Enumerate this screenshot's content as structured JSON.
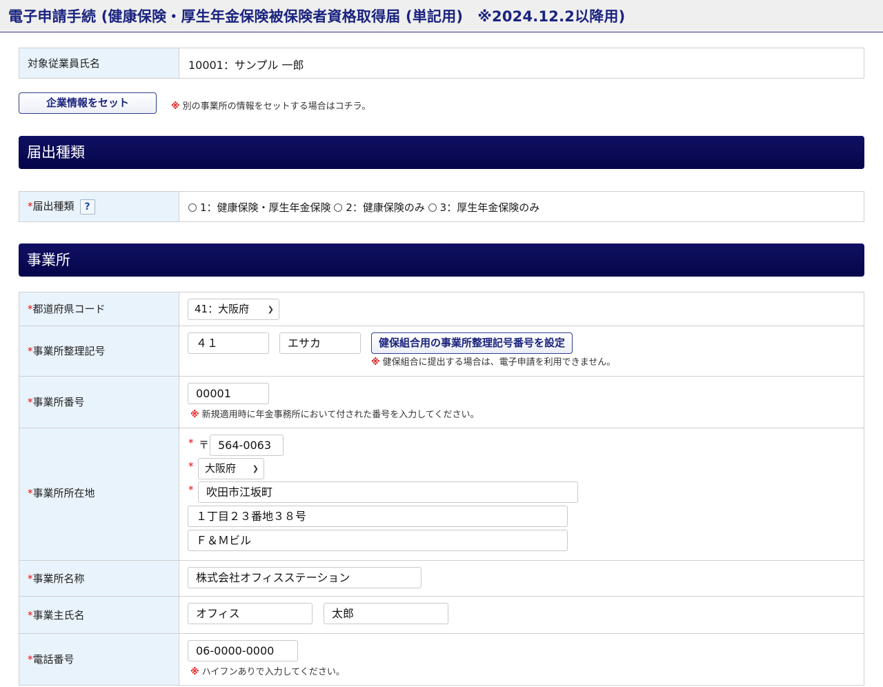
{
  "header": {
    "title": "電子申請手続 (健康保険・厚生年金保険被保険者資格取得届 (単記用)　※2024.12.2以降用)"
  },
  "employee": {
    "label": "対象従業員氏名",
    "value": "10001：サンプル 一郎"
  },
  "company_set": {
    "button_label": "企業情報をセット",
    "note_mark": "※",
    "note": "別の事業所の情報をセットする場合はコチラ。"
  },
  "sections": {
    "notification_type": "届出種類",
    "office": "事業所"
  },
  "notification": {
    "required_mark": "*",
    "label": "届出種類",
    "help_icon": "?",
    "options": [
      "1：健康保険・厚生年金保険",
      "2：健康保険のみ",
      "3：厚生年金保険のみ"
    ]
  },
  "office": {
    "required_mark": "*",
    "note_mark": "※",
    "prefecture_code": {
      "label": "都道府県コード",
      "value": "41：大阪府"
    },
    "office_symbol": {
      "label": "事業所整理記号",
      "value1": "４１",
      "value2": "エサカ",
      "button_label": "健保組合用の事業所整理記号番号を設定",
      "note": "健保組合に提出する場合は、電子申請を利用できません。"
    },
    "office_number": {
      "label": "事業所番号",
      "value": "00001",
      "note": "新規適用時に年金事務所において付された番号を入力してください。"
    },
    "address": {
      "label": "事業所所在地",
      "postal_mark": "〒",
      "postal_code": "564-0063",
      "prefecture": "大阪府",
      "city": "吹田市江坂町",
      "street": "１丁目２３番地３８号",
      "building": "Ｆ＆Ｍビル"
    },
    "name": {
      "label": "事業所名称",
      "value": "株式会社オフィスステーション"
    },
    "owner": {
      "label": "事業主氏名",
      "last_name": "オフィス",
      "first_name": "太郎"
    },
    "phone": {
      "label": "電話番号",
      "value": "06-0000-0000",
      "note": "ハイフンありで入力してください。"
    }
  }
}
